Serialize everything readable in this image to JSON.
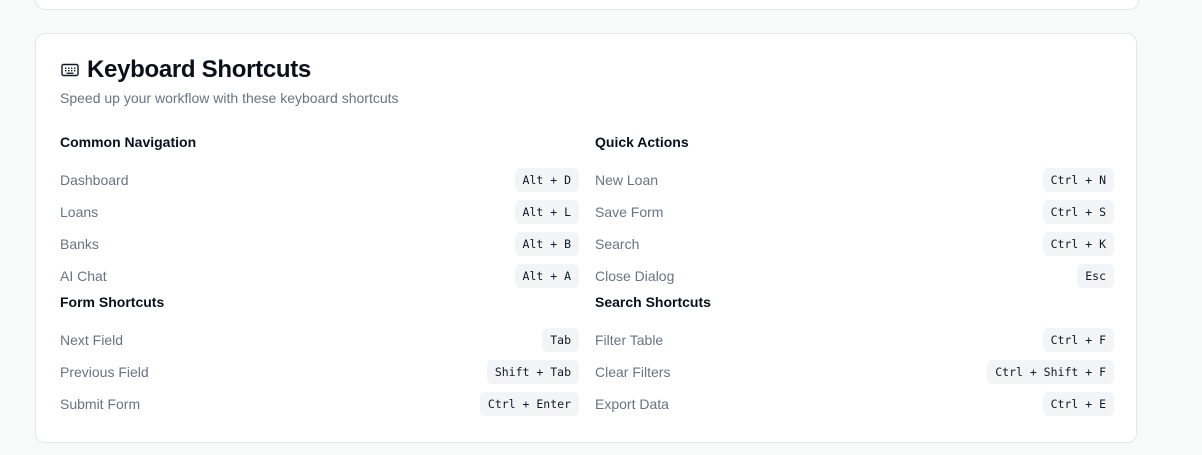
{
  "card": {
    "title": "Keyboard Shortcuts",
    "subtitle": "Speed up your workflow with these keyboard shortcuts",
    "icon": "keyboard-icon"
  },
  "groups": {
    "common_navigation": {
      "title": "Common Navigation",
      "items": [
        {
          "label": "Dashboard",
          "keys": "Alt + D"
        },
        {
          "label": "Loans",
          "keys": "Alt + L"
        },
        {
          "label": "Banks",
          "keys": "Alt + B"
        },
        {
          "label": "AI Chat",
          "keys": "Alt + A"
        }
      ]
    },
    "quick_actions": {
      "title": "Quick Actions",
      "items": [
        {
          "label": "New Loan",
          "keys": "Ctrl + N"
        },
        {
          "label": "Save Form",
          "keys": "Ctrl + S"
        },
        {
          "label": "Search",
          "keys": "Ctrl + K"
        },
        {
          "label": "Close Dialog",
          "keys": "Esc"
        }
      ]
    },
    "form_shortcuts": {
      "title": "Form Shortcuts",
      "items": [
        {
          "label": "Next Field",
          "keys": "Tab"
        },
        {
          "label": "Previous Field",
          "keys": "Shift + Tab"
        },
        {
          "label": "Submit Form",
          "keys": "Ctrl + Enter"
        }
      ]
    },
    "search_shortcuts": {
      "title": "Search Shortcuts",
      "items": [
        {
          "label": "Filter Table",
          "keys": "Ctrl + F"
        },
        {
          "label": "Clear Filters",
          "keys": "Ctrl + Shift + F"
        },
        {
          "label": "Export Data",
          "keys": "Ctrl + E"
        }
      ]
    }
  }
}
